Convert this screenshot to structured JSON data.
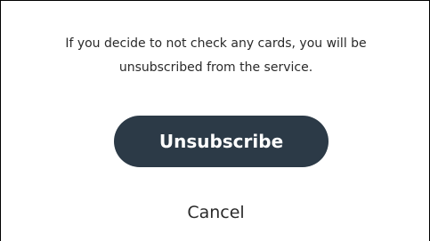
{
  "dialog": {
    "message_line1": "If you decide to not check any cards, you will be",
    "message_line2": "unsubscribed from the service.",
    "unsubscribe_label": "Unsubscribe",
    "cancel_label": "Cancel"
  },
  "colors": {
    "button_background": "#2c3a47",
    "button_text": "#ffffff",
    "text": "#2a2a2a",
    "border": "#000000",
    "background": "#ffffff"
  }
}
